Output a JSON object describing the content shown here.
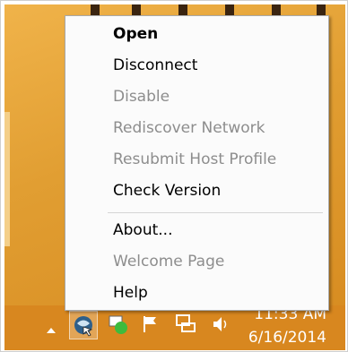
{
  "context_menu": {
    "items": [
      {
        "label": "Open",
        "state": "default"
      },
      {
        "label": "Disconnect",
        "state": "enabled"
      },
      {
        "label": "Disable",
        "state": "disabled"
      },
      {
        "label": "Rediscover Network",
        "state": "disabled"
      },
      {
        "label": "Resubmit Host Profile",
        "state": "disabled"
      },
      {
        "label": "Check Version",
        "state": "enabled"
      },
      {
        "label": "About...",
        "state": "enabled"
      },
      {
        "label": "Welcome Page",
        "state": "disabled"
      },
      {
        "label": "Help",
        "state": "enabled"
      }
    ]
  },
  "taskbar": {
    "tray_icons": [
      "show-hidden-icons-arrow",
      "network-agent-icon",
      "green-status-icon",
      "action-center-flag-icon",
      "network-icon",
      "speaker-volume-icon"
    ],
    "clock": {
      "time": "11:33 AM",
      "date": "6/16/2014"
    }
  },
  "colors": {
    "wallpaper": "#e19e32",
    "taskbar": "#d8871f",
    "menu_background": "#fbfbfb",
    "disabled_text": "#8d8d8d"
  }
}
